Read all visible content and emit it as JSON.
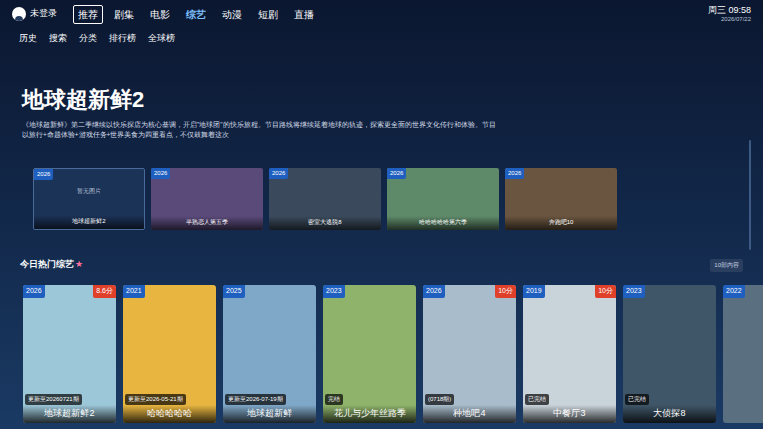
{
  "top_bar": {
    "user": {
      "label": "未登录"
    },
    "tabs": [
      {
        "label": "推荐",
        "selected": false,
        "focused": true
      },
      {
        "label": "剧集",
        "selected": false,
        "focused": false
      },
      {
        "label": "电影",
        "selected": false,
        "focused": false
      },
      {
        "label": "综艺",
        "selected": true,
        "focused": false
      },
      {
        "label": "动漫",
        "selected": false,
        "focused": false
      },
      {
        "label": "短剧",
        "selected": false,
        "focused": false
      },
      {
        "label": "直播",
        "selected": false,
        "focused": false
      }
    ],
    "clock": {
      "time": "周三 09:58",
      "date": "2026/07/22"
    }
  },
  "sub_nav": [
    "历史",
    "搜索",
    "分类",
    "排行榜",
    "全球榜"
  ],
  "hero": {
    "title": "地球超新鲜2",
    "description": "《地球超新鲜》第二季继续以快乐探店为核心基调，开启\"地球团\"的快乐旅程。节目路线将继续延着地球的轨迹，探索更全面的世界文化传行和体验。节目以旅行+命题体验+游戏任务+世界美食为四重看点，不仅鼓舞着这次"
  },
  "featured": [
    {
      "year": "2026",
      "caption": "地球超新鲜2",
      "placeholder": "暂无图片",
      "focused": true
    },
    {
      "year": "2026",
      "caption": "半熟恋人第五季",
      "placeholder": "",
      "focused": false
    },
    {
      "year": "2026",
      "caption": "密室大逃脱8",
      "placeholder": "",
      "focused": false
    },
    {
      "year": "2026",
      "caption": "哈哈哈哈哈第六季",
      "placeholder": "",
      "focused": false
    },
    {
      "year": "2026",
      "caption": "奔跑吧10",
      "placeholder": "",
      "focused": false
    }
  ],
  "section": {
    "title": "今日热门综艺",
    "icon": "★",
    "count": "10部内容"
  },
  "cards": [
    {
      "year": "2026",
      "score": "8.6分",
      "status": "更新至20260721期",
      "title": "地球超新鲜2"
    },
    {
      "year": "2021",
      "score": "",
      "status": "更新至2026-05-21期",
      "title": "哈哈哈哈哈"
    },
    {
      "year": "2025",
      "score": "",
      "status": "更新至2026-07-19期",
      "title": "地球超新鲜"
    },
    {
      "year": "2023",
      "score": "",
      "status": "完结",
      "title": "花儿与少年丝路季"
    },
    {
      "year": "2026",
      "score": "10分",
      "status": "(0718期)",
      "title": "种地吧4"
    },
    {
      "year": "2019",
      "score": "10分",
      "status": "已完结",
      "title": "中餐厅3"
    },
    {
      "year": "2023",
      "score": "",
      "status": "已完结",
      "title": "大侦探8"
    },
    {
      "year": "2022",
      "score": "",
      "status": "",
      "title": ""
    }
  ]
}
